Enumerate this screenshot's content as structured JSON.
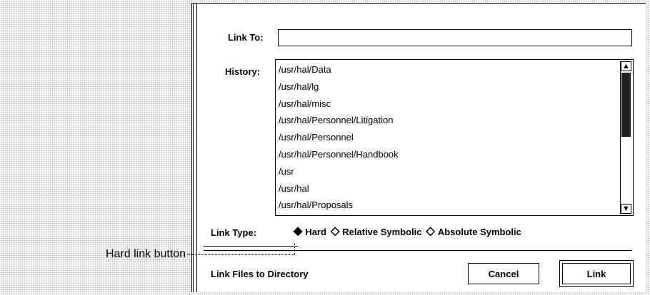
{
  "dialog": {
    "link_to_label": "Link To:",
    "link_to_value": "",
    "history_label": "History:",
    "history_items": [
      "/usr/hal/Data",
      "/usr/hal/lg",
      "/usr/hal/misc",
      "/usr/hal/Personnel/Litigation",
      "/usr/hal/Personnel",
      "/usr/hal/Personnel/Handbook",
      "/usr",
      "/usr/hal",
      "/usr/hal/Proposals"
    ],
    "link_type_label": "Link Type:",
    "link_types": [
      {
        "label": "Hard",
        "selected": true
      },
      {
        "label": "Relative Symbolic",
        "selected": false
      },
      {
        "label": "Absolute Symbolic",
        "selected": false
      }
    ],
    "footer_title": "Link Files to Directory",
    "cancel_label": "Cancel",
    "link_label": "Link"
  },
  "callout": {
    "text": "Hard link button"
  }
}
